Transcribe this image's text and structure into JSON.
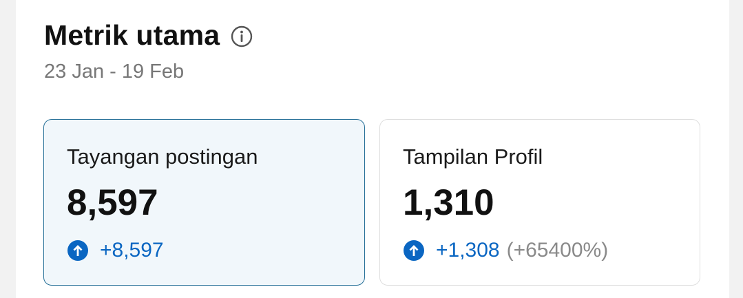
{
  "header": {
    "title": "Metrik utama",
    "date_range": "23 Jan - 19 Feb"
  },
  "metrics": [
    {
      "label": "Tayangan postingan",
      "value": "8,597",
      "change": "+8,597",
      "change_pct": "",
      "selected": true
    },
    {
      "label": "Tampilan Profil",
      "value": "1,310",
      "change": "+1,308",
      "change_pct": "(+65400%)",
      "selected": false
    }
  ],
  "colors": {
    "accent": "#0a66c2",
    "selected_border": "#256f97",
    "selected_bg": "#f1f7fb"
  },
  "icons": {
    "info": "info-icon",
    "trend_up": "arrow-up-circle-icon"
  }
}
